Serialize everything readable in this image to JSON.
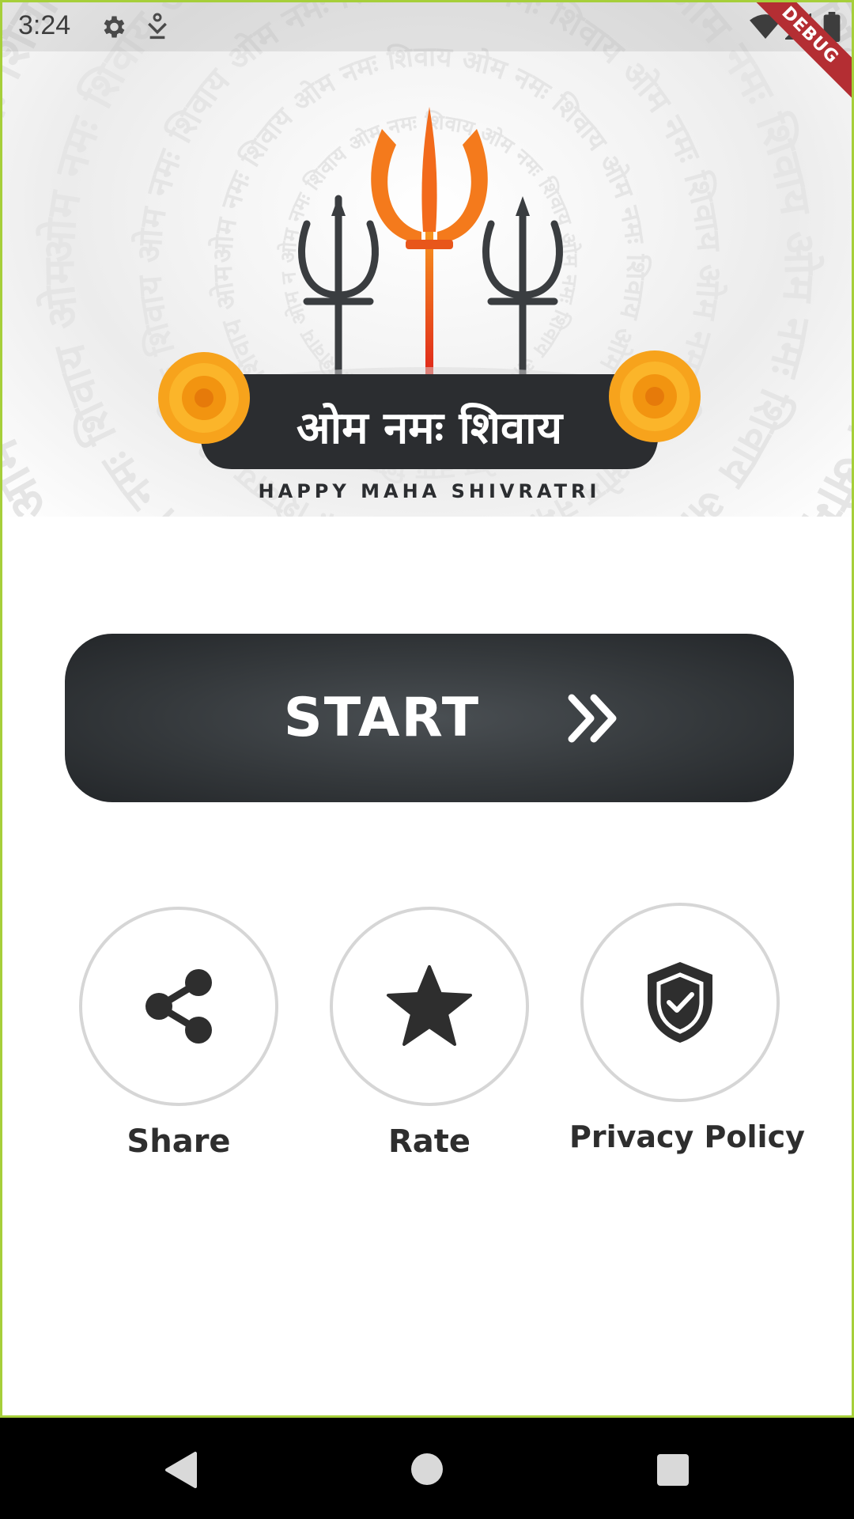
{
  "status_bar": {
    "time": "3:24",
    "icons": [
      "gear-icon",
      "person-download-icon",
      "wifi-icon",
      "signal-icon",
      "battery-icon"
    ]
  },
  "debug_banner": "DEBUG",
  "header": {
    "mantra_title": "ओम नमः शिवाय",
    "tagline": "HAPPY MAHA SHIVRATRI",
    "background_mantra": "ओम नमः शिवाय",
    "colors": {
      "trident_main": "#f26a1b",
      "trident_side": "#3a3d40",
      "marigold": "#f7a31c",
      "banner": "#2b2d30"
    }
  },
  "start_button": {
    "label": "START",
    "icon": "double-chevron-right-icon",
    "color": "#34383b"
  },
  "actions": [
    {
      "label": "Share",
      "icon": "share-icon"
    },
    {
      "label": "Rate",
      "icon": "star-icon"
    },
    {
      "label": "Privacy Policy",
      "icon": "shield-check-icon"
    }
  ],
  "nav_bar": {
    "icons": [
      "back-icon",
      "home-icon",
      "recents-icon"
    ]
  },
  "colors": {
    "frame_border": "#a6cf3a",
    "icon_dark": "#2e2e2e",
    "circle_border": "#d6d6d6"
  }
}
